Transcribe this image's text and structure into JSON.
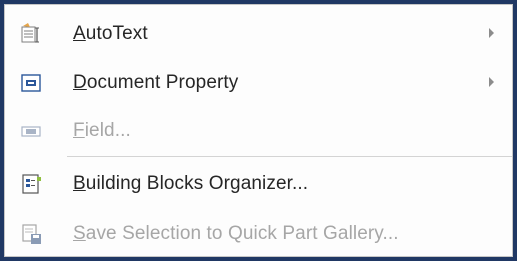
{
  "menu": {
    "items": [
      {
        "label": "AutoText",
        "mnemonic": "A",
        "rest": "utoText",
        "icon": "autotext-icon",
        "submenu": true,
        "enabled": true
      },
      {
        "label": "Document Property",
        "mnemonic": "D",
        "rest": "ocument Property",
        "icon": "document-property-icon",
        "submenu": true,
        "enabled": true
      },
      {
        "label": "Field...",
        "mnemonic": "F",
        "rest": "ield...",
        "icon": "field-icon",
        "submenu": false,
        "enabled": false
      },
      {
        "label": "Building Blocks Organizer...",
        "mnemonic": "B",
        "rest": "uilding Blocks Organizer...",
        "icon": "building-blocks-icon",
        "submenu": false,
        "enabled": true
      },
      {
        "label": "Save Selection to Quick Part Gallery...",
        "mnemonic": "S",
        "rest": "ave Selection to Quick Part Gallery...",
        "icon": "save-selection-icon",
        "submenu": false,
        "enabled": false
      }
    ]
  },
  "colors": {
    "background": "#203864",
    "menu": "#fdfdfd",
    "text": "#262626",
    "disabled_text": "#a6a6a6",
    "icon_blue": "#2b579a"
  }
}
